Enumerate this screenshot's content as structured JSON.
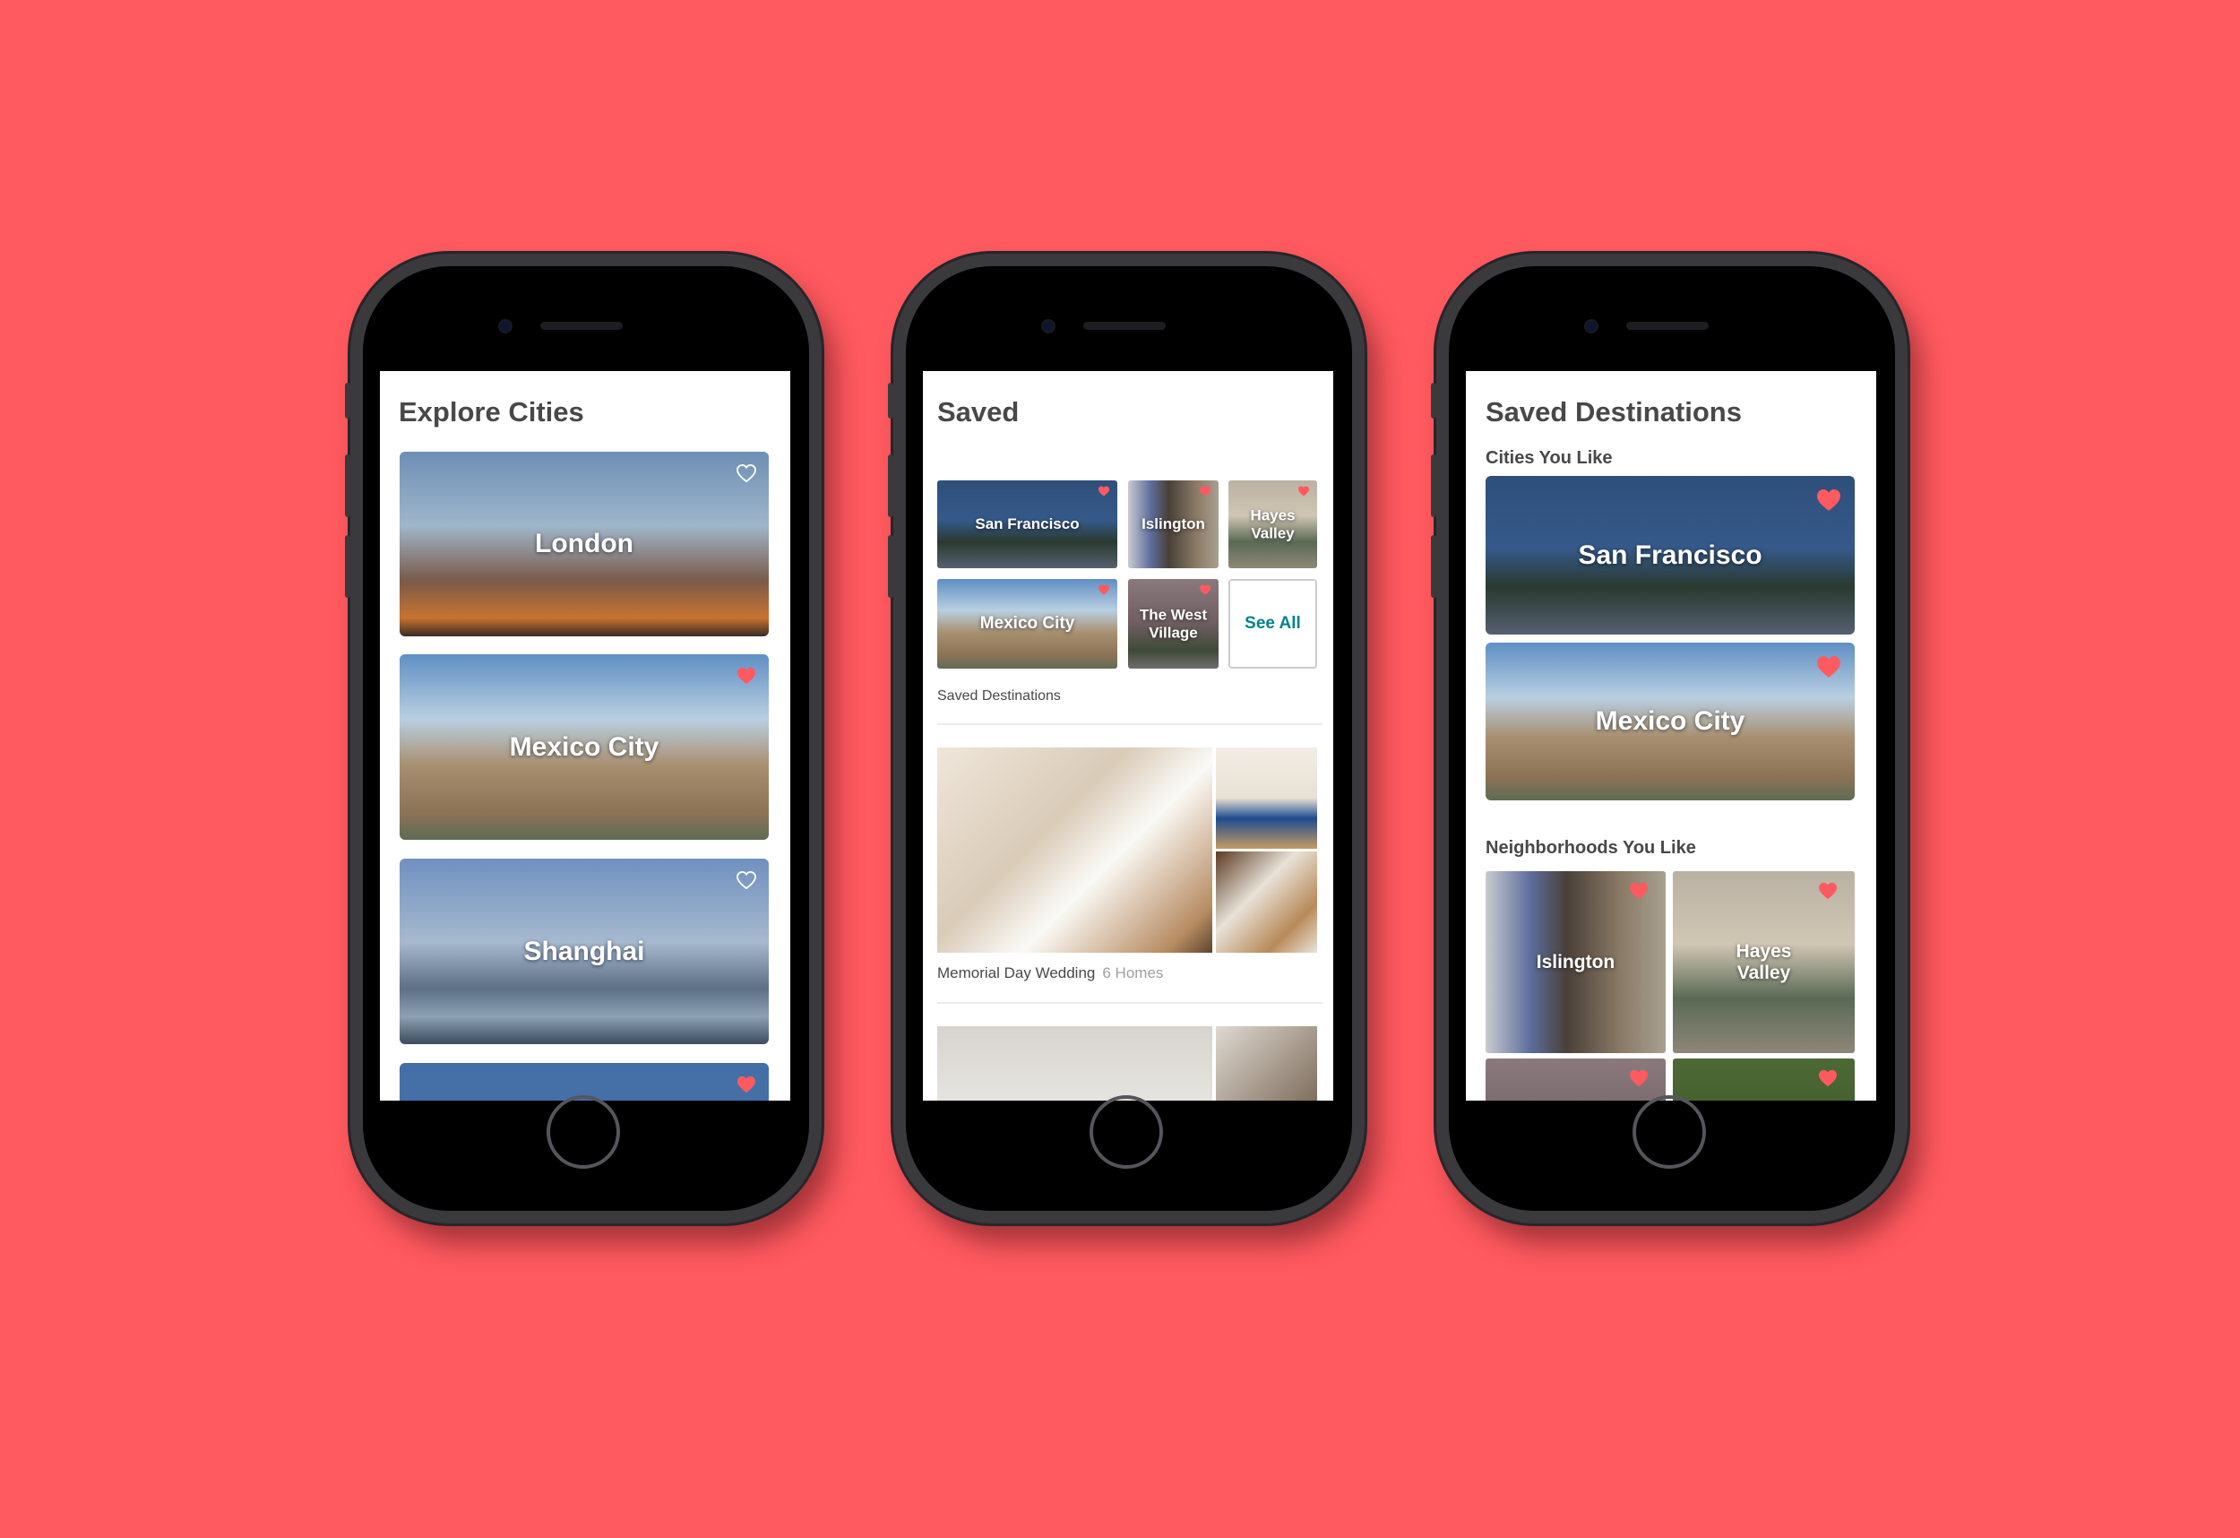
{
  "colors": {
    "background": "#ff5a5f",
    "heart": "#ff5a5f",
    "accent": "#00848a"
  },
  "phones": [
    {
      "title": "Explore Cities",
      "cities": [
        {
          "name": "London",
          "saved": false
        },
        {
          "name": "Mexico City",
          "saved": true
        },
        {
          "name": "Shanghai",
          "saved": false
        },
        {
          "name": "",
          "saved": true
        }
      ]
    },
    {
      "title": "Saved",
      "destinations": [
        {
          "name": "San Francisco",
          "saved": true
        },
        {
          "name": "Islington",
          "saved": true
        },
        {
          "name": "Hayes Valley",
          "saved": true
        },
        {
          "name": "Mexico City",
          "saved": true
        },
        {
          "name": "The West Village",
          "saved": true
        }
      ],
      "see_all": "See All",
      "section_label": "Saved Destinations",
      "wishlists": [
        {
          "name": "Memorial Day Wedding",
          "count": "6 Homes"
        }
      ]
    },
    {
      "title": "Saved Destinations",
      "cities_label": "Cities You Like",
      "cities": [
        {
          "name": "San Francisco",
          "saved": true
        },
        {
          "name": "Mexico City",
          "saved": true
        }
      ],
      "neighborhoods_label": "Neighborhoods You Like",
      "neighborhoods": [
        {
          "name": "Islington",
          "saved": true
        },
        {
          "name": "Hayes Valley",
          "saved": true
        },
        {
          "name": "",
          "saved": true
        },
        {
          "name": "",
          "saved": true
        }
      ]
    }
  ]
}
